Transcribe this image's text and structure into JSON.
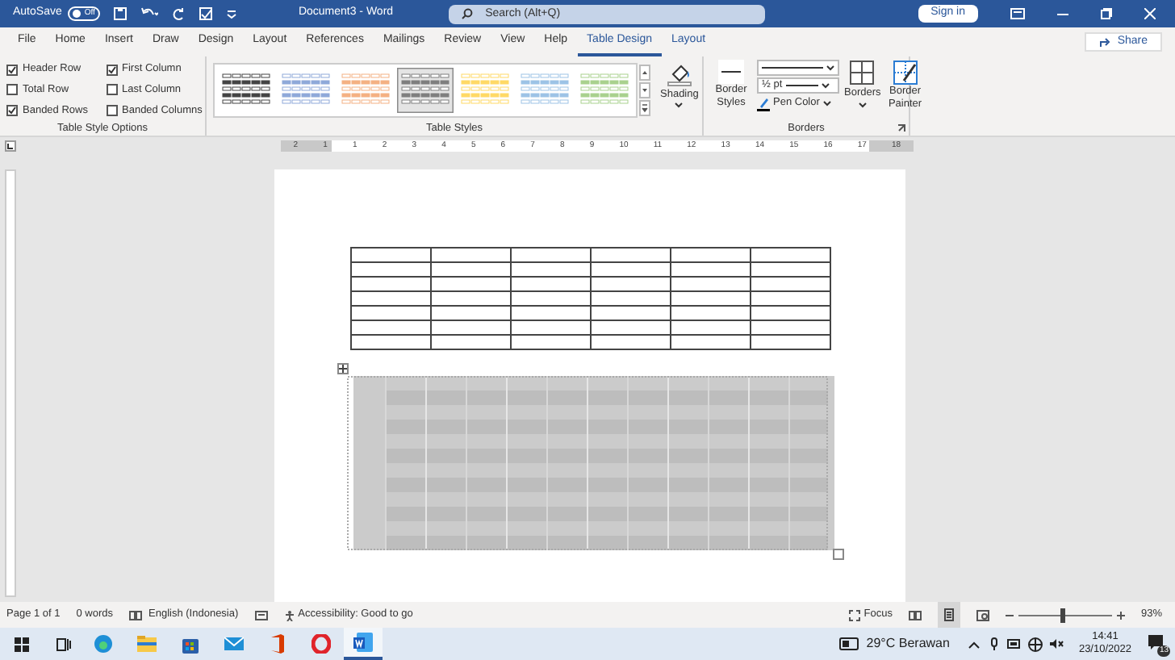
{
  "title_bar": {
    "autosave_label": "AutoSave",
    "autosave_toggle": {
      "on": false,
      "label": "Off"
    },
    "document_title": "Document3 - Word",
    "search_placeholder": "Search (Alt+Q)",
    "sign_in": "Sign in"
  },
  "tabs": [
    {
      "label": "File",
      "selected": false
    },
    {
      "label": "Home",
      "selected": false
    },
    {
      "label": "Insert",
      "selected": false
    },
    {
      "label": "Draw",
      "selected": false
    },
    {
      "label": "Design",
      "selected": false
    },
    {
      "label": "Layout",
      "selected": false
    },
    {
      "label": "References",
      "selected": false
    },
    {
      "label": "Mailings",
      "selected": false
    },
    {
      "label": "Review",
      "selected": false
    },
    {
      "label": "View",
      "selected": false
    },
    {
      "label": "Help",
      "selected": false
    },
    {
      "label": "Table Design",
      "selected": true
    },
    {
      "label": "Layout",
      "selected": false,
      "contextual": true
    }
  ],
  "share": "Share",
  "table_style_options": {
    "label": "Table Style Options",
    "options": [
      {
        "label": "Header Row",
        "checked": true
      },
      {
        "label": "Total Row",
        "checked": false
      },
      {
        "label": "Banded Rows",
        "checked": true
      },
      {
        "label": "First Column",
        "checked": true
      },
      {
        "label": "Last Column",
        "checked": false
      },
      {
        "label": "Banded Columns",
        "checked": false
      }
    ]
  },
  "table_styles": {
    "label": "Table Styles",
    "styles": [
      {
        "color": "#444444",
        "selected": false
      },
      {
        "color": "#8fa9d9",
        "selected": false
      },
      {
        "color": "#f4b183",
        "selected": false
      },
      {
        "color": "#7f7f7f",
        "selected": true
      },
      {
        "color": "#ffd966",
        "selected": false
      },
      {
        "color": "#9dc3e6",
        "selected": false
      },
      {
        "color": "#a9d18e",
        "selected": false
      }
    ],
    "shading": "Shading"
  },
  "borders": {
    "label": "Borders",
    "border_styles": "Border Styles",
    "weight": "½ pt",
    "pen_color": "Pen Color",
    "borders_button": "Borders",
    "border_painter": "Border Painter"
  },
  "ruler_numbers": [
    "2",
    "1",
    "1",
    "2",
    "3",
    "4",
    "5",
    "6",
    "7",
    "8",
    "9",
    "10",
    "11",
    "12",
    "13",
    "14",
    "15",
    "16",
    "17",
    "18"
  ],
  "tables": [
    {
      "kind": "plain",
      "selected": false
    },
    {
      "kind": "shaded",
      "selected": true
    }
  ],
  "status_bar": {
    "page": "Page 1 of 1",
    "words": "0 words",
    "language": "English (Indonesia)",
    "accessibility": "Accessibility: Good to go",
    "focus": "Focus",
    "zoom": {
      "level": 0.45
    },
    "zoom_percent": "93%"
  },
  "taskbar": {
    "weather": "29°C Berawan",
    "time": "14:41",
    "date": "23/10/2022",
    "notifications": "13"
  }
}
